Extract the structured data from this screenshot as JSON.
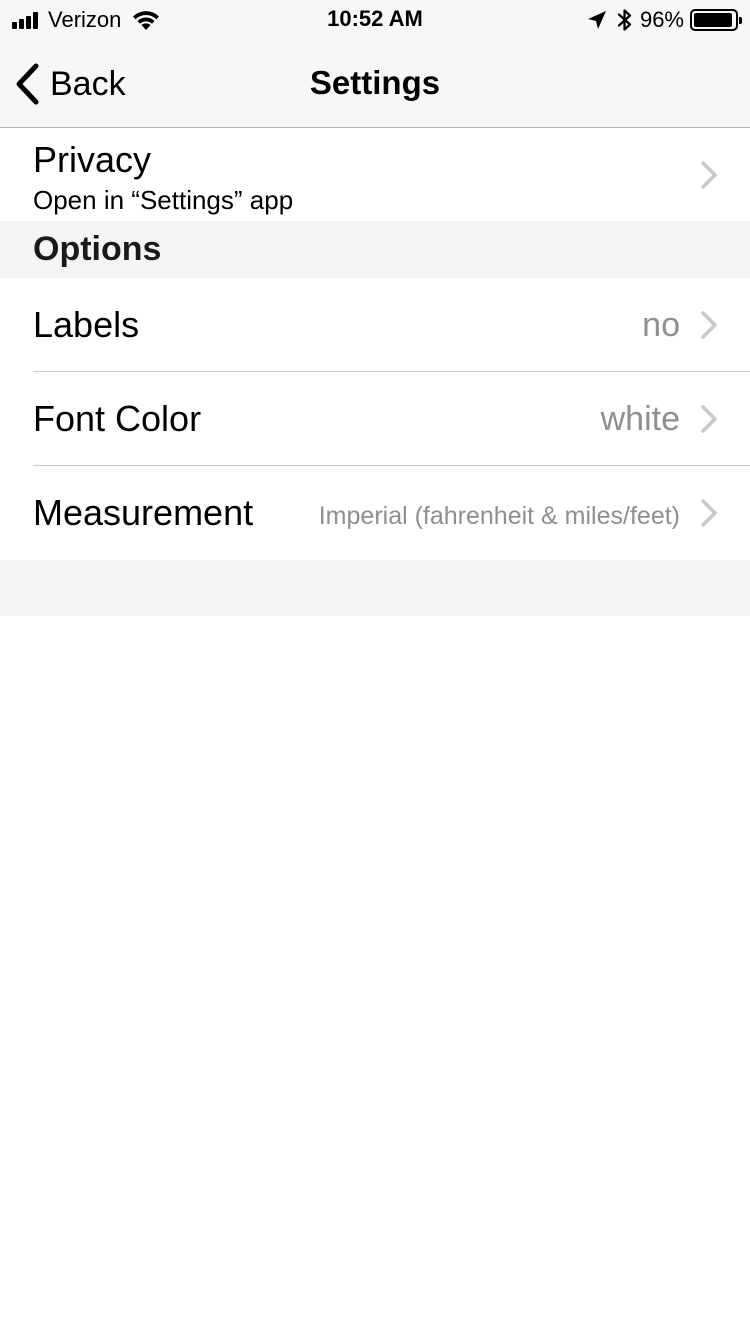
{
  "status_bar": {
    "carrier": "Verizon",
    "time": "10:52 AM",
    "battery_percent": "96%",
    "battery_level": 0.96,
    "icons": [
      "signal-icon",
      "wifi-icon",
      "location-icon",
      "bluetooth-icon",
      "battery-icon"
    ]
  },
  "nav": {
    "back_label": "Back",
    "title": "Settings"
  },
  "privacy": {
    "title": "Privacy",
    "subtitle": "Open in “Settings” app"
  },
  "options": {
    "header": "Options",
    "rows": [
      {
        "label": "Labels",
        "value": "no"
      },
      {
        "label": "Font Color",
        "value": "white"
      },
      {
        "label": "Measurement",
        "value": "Imperial (fahrenheit & miles/feet)"
      }
    ]
  },
  "colors": {
    "secondary_text": "#8e8e93",
    "chevron": "#c7c7cc",
    "bar_background": "#f7f7f7",
    "section_background": "#f5f5f5"
  }
}
